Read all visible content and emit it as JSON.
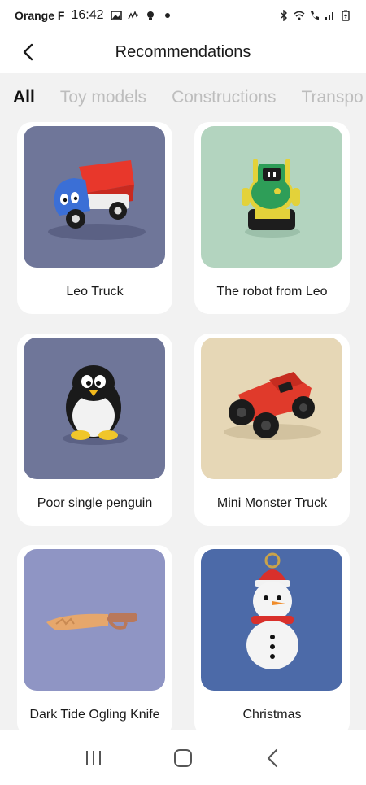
{
  "status_bar": {
    "carrier": "Orange F",
    "time": "16:42"
  },
  "header": {
    "title": "Recommendations",
    "back_icon": "chevron-left-icon"
  },
  "tabs": [
    {
      "label": "All",
      "active": true
    },
    {
      "label": "Toy models",
      "active": false
    },
    {
      "label": "Constructions",
      "active": false
    },
    {
      "label": "Transpo",
      "active": false
    }
  ],
  "cards": [
    {
      "label": "Leo Truck",
      "bg": "#6f7699"
    },
    {
      "label": "The robot from Leo",
      "bg": "#b3d4bf"
    },
    {
      "label": "Poor single penguin",
      "bg": "#6f7699"
    },
    {
      "label": "Mini Monster Truck",
      "bg": "#e6d7b6"
    },
    {
      "label": "Dark Tide Ogling Knife",
      "bg": "#8f95c4"
    },
    {
      "label": "Christmas",
      "bg": "#4c6aa8"
    }
  ],
  "navbar": {
    "recent_icon": "recent-apps-icon",
    "home_icon": "home-icon",
    "back_icon": "back-icon"
  }
}
